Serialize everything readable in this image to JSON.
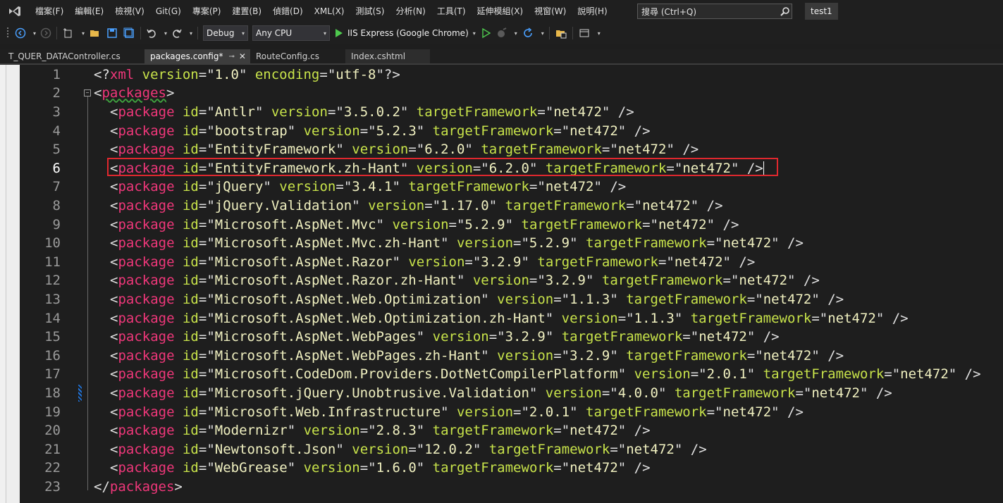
{
  "menu": {
    "items": [
      "檔案(F)",
      "編輯(E)",
      "檢視(V)",
      "Git(G)",
      "專案(P)",
      "建置(B)",
      "偵錯(D)",
      "XML(X)",
      "測試(S)",
      "分析(N)",
      "工具(T)",
      "延伸模組(X)",
      "視窗(W)",
      "說明(H)"
    ],
    "search_placeholder": "搜尋 (Ctrl+Q)",
    "project_name": "test1"
  },
  "toolbar": {
    "config": "Debug",
    "platform": "Any CPU",
    "run_target": "IIS Express (Google Chrome)"
  },
  "tabs": [
    {
      "label": "T_QUER_DATAController.cs",
      "active": false
    },
    {
      "label": "packages.config*",
      "active": true
    },
    {
      "label": "RouteConfig.cs",
      "active": false
    },
    {
      "label": "Index.cshtml",
      "active": false
    }
  ],
  "editor": {
    "current_line": 6,
    "lines": [
      {
        "n": "1",
        "xmldecl": true,
        "version": "1.0",
        "encoding": "utf-8"
      },
      {
        "n": "2",
        "open": "packages"
      },
      {
        "n": "3",
        "id": "Antlr",
        "version": "3.5.0.2",
        "tf": "net472"
      },
      {
        "n": "4",
        "id": "bootstrap",
        "version": "5.2.3",
        "tf": "net472"
      },
      {
        "n": "5",
        "id": "EntityFramework",
        "version": "6.2.0",
        "tf": "net472"
      },
      {
        "n": "6",
        "id": "EntityFramework.zh-Hant",
        "version": "6.2.0",
        "tf": "net472"
      },
      {
        "n": "7",
        "id": "jQuery",
        "version": "3.4.1",
        "tf": "net472"
      },
      {
        "n": "8",
        "id": "jQuery.Validation",
        "version": "1.17.0",
        "tf": "net472"
      },
      {
        "n": "9",
        "id": "Microsoft.AspNet.Mvc",
        "version": "5.2.9",
        "tf": "net472"
      },
      {
        "n": "10",
        "id": "Microsoft.AspNet.Mvc.zh-Hant",
        "version": "5.2.9",
        "tf": "net472"
      },
      {
        "n": "11",
        "id": "Microsoft.AspNet.Razor",
        "version": "3.2.9",
        "tf": "net472"
      },
      {
        "n": "12",
        "id": "Microsoft.AspNet.Razor.zh-Hant",
        "version": "3.2.9",
        "tf": "net472"
      },
      {
        "n": "13",
        "id": "Microsoft.AspNet.Web.Optimization",
        "version": "1.1.3",
        "tf": "net472"
      },
      {
        "n": "14",
        "id": "Microsoft.AspNet.Web.Optimization.zh-Hant",
        "version": "1.1.3",
        "tf": "net472"
      },
      {
        "n": "15",
        "id": "Microsoft.AspNet.WebPages",
        "version": "3.2.9",
        "tf": "net472"
      },
      {
        "n": "16",
        "id": "Microsoft.AspNet.WebPages.zh-Hant",
        "version": "3.2.9",
        "tf": "net472"
      },
      {
        "n": "17",
        "id": "Microsoft.CodeDom.Providers.DotNetCompilerPlatform",
        "version": "2.0.1",
        "tf": "net472"
      },
      {
        "n": "18",
        "id": "Microsoft.jQuery.Unobtrusive.Validation",
        "version": "4.0.0",
        "tf": "net472"
      },
      {
        "n": "19",
        "id": "Microsoft.Web.Infrastructure",
        "version": "2.0.1",
        "tf": "net472"
      },
      {
        "n": "20",
        "id": "Modernizr",
        "version": "2.8.3",
        "tf": "net472"
      },
      {
        "n": "21",
        "id": "Newtonsoft.Json",
        "version": "12.0.2",
        "tf": "net472"
      },
      {
        "n": "22",
        "id": "WebGrease",
        "version": "1.6.0",
        "tf": "net472"
      },
      {
        "n": "23",
        "close": "packages"
      }
    ]
  },
  "colors": {
    "tag": "#f0377a",
    "attr": "#c8e34a",
    "value": "#f0f0c0",
    "highlight_border": "#e0282e"
  }
}
